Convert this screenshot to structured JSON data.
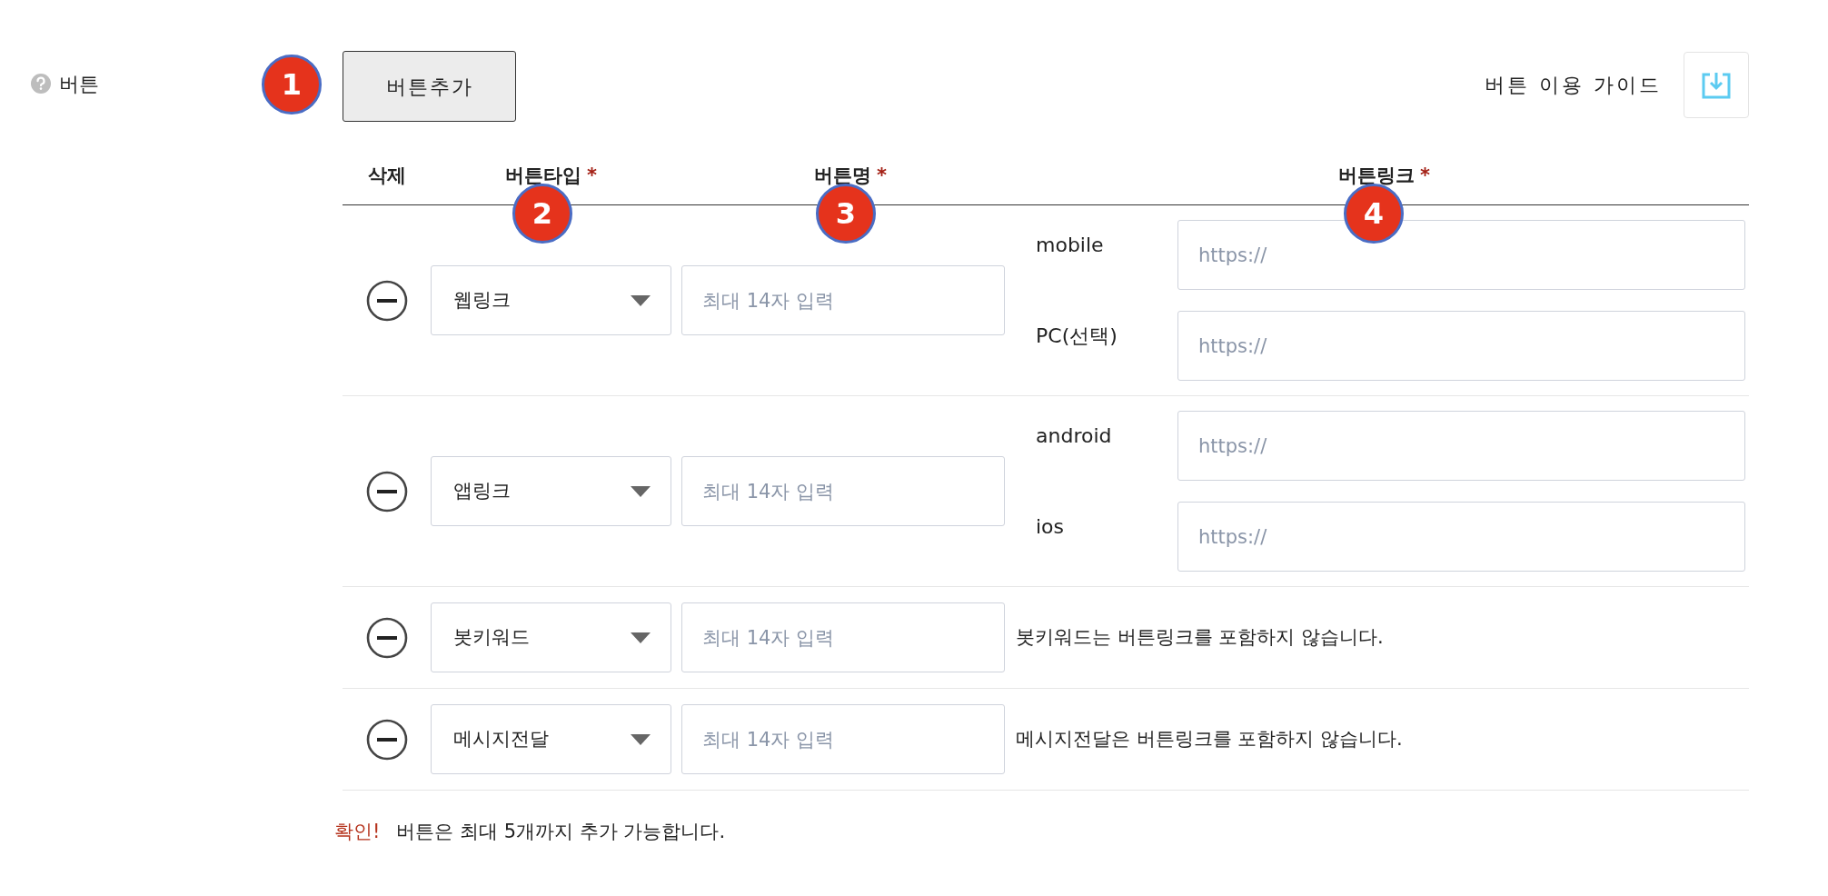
{
  "field_label": "버튼",
  "add_button": "버튼추가",
  "guide": {
    "label": "버튼 이용 가이드"
  },
  "columns": [
    {
      "label": "삭제",
      "required": false
    },
    {
      "label": "버튼타입",
      "required": true
    },
    {
      "label": "버튼명",
      "required": true
    },
    {
      "label": "버튼링크",
      "required": true
    }
  ],
  "required_mark": "*",
  "rows": [
    {
      "kind": "links",
      "type": "웹링크",
      "name_placeholder": "최대 14자 입력",
      "links": [
        {
          "label": "mobile",
          "placeholder": "https://"
        },
        {
          "label": "PC(선택)",
          "placeholder": "https://"
        }
      ]
    },
    {
      "kind": "links",
      "type": "앱링크",
      "name_placeholder": "최대 14자 입력",
      "links": [
        {
          "label": "android",
          "placeholder": "https://"
        },
        {
          "label": "ios",
          "placeholder": "https://"
        }
      ]
    },
    {
      "kind": "note",
      "type": "봇키워드",
      "name_placeholder": "최대 14자 입력",
      "note": "봇키워드는 버튼링크를 포함하지 않습니다."
    },
    {
      "kind": "note",
      "type": "메시지전달",
      "name_placeholder": "최대 14자 입력",
      "note": "메시지전달은 버튼링크를 포함하지 않습니다."
    }
  ],
  "footer": {
    "alert": "확인!",
    "text": "버튼은 최대 5개까지 추가 가능합니다."
  },
  "markers": [
    "1",
    "2",
    "3",
    "4"
  ]
}
